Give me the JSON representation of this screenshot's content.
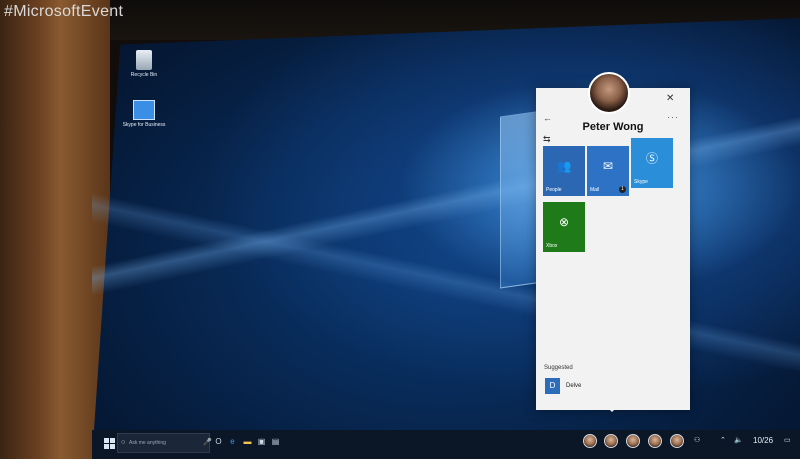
{
  "overlay": {
    "hashtag": "#MicrosoftEvent"
  },
  "desktop": {
    "icons": [
      {
        "label": "Recycle Bin",
        "icon": "recycle-bin-icon"
      },
      {
        "label": "Skype for Business",
        "icon": "app-shortcut-icon"
      }
    ]
  },
  "people_panel": {
    "contact_name": "Peter Wong",
    "back_symbol": "←",
    "close_symbol": "✕",
    "more_symbol": "···",
    "pin_symbol": "⇆",
    "tiles": [
      {
        "label": "People",
        "icon": "people-icon",
        "color": "#2b67b2"
      },
      {
        "label": "Mail",
        "icon": "mail-icon",
        "color": "#2d72c4",
        "badge": "1"
      },
      {
        "label": "Skype",
        "icon": "skype-icon",
        "color": "#2a8ed8"
      },
      {
        "label": "Xbox",
        "icon": "xbox-icon",
        "color": "#1f7a1a"
      }
    ],
    "suggested_heading": "Suggested",
    "suggested_items": [
      {
        "label": "Delve",
        "icon": "delve-icon"
      }
    ]
  },
  "taskbar": {
    "search_placeholder": "Ask me anything",
    "clock": "10/26",
    "pinned_apps": [
      "cortana-icon",
      "edge-icon",
      "file-explorer-icon",
      "store-icon",
      "photos-icon"
    ],
    "people_count": 5
  }
}
